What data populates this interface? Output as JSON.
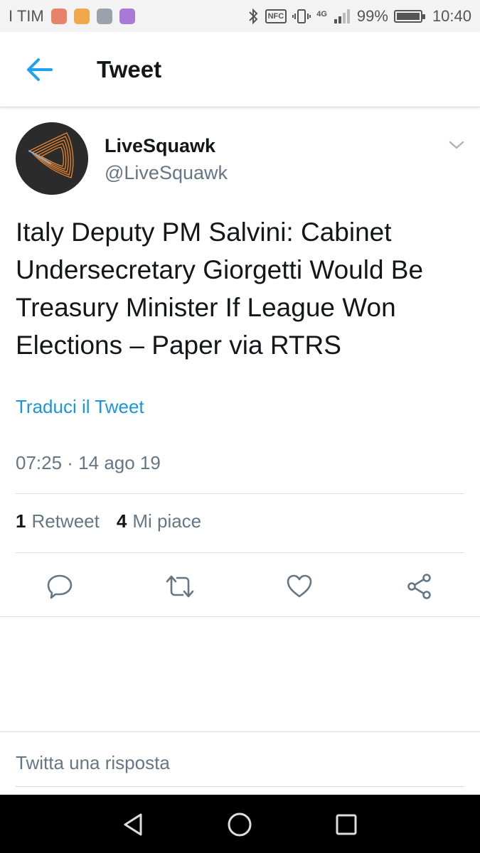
{
  "status_bar": {
    "carrier": "I TIM",
    "network": "4G",
    "nfc_label": "NFC",
    "battery_percent_label": "99%",
    "battery_level": 0.99,
    "time": "10:40",
    "notification_icons": [
      {
        "name": "mail-notification-icon",
        "color": "#e8836b"
      },
      {
        "name": "lock-notification-icon",
        "color": "#f0a84a"
      },
      {
        "name": "gallery-notification-icon",
        "color": "#9aa3ab"
      },
      {
        "name": "keyboard-notification-icon",
        "color": "#a879d6"
      }
    ]
  },
  "app_bar": {
    "title": "Tweet",
    "back_icon": "arrow-left-icon",
    "accent_color": "#1da1f2"
  },
  "tweet": {
    "author_name": "LiveSquawk",
    "author_handle": "@LiveSquawk",
    "text": "Italy Deputy PM Salvini: Cabinet Undersecretary Giorgetti Would Be Treasury Minister If League Won Elections – Paper  via RTRS",
    "translate_label": "Traduci il Tweet",
    "timestamp": "07:25 · 14 ago 19",
    "retweet_count": "1",
    "retweet_label": "Retweet",
    "like_count": "4",
    "like_label": "Mi piace"
  },
  "actions": [
    {
      "name": "reply-icon"
    },
    {
      "name": "retweet-icon"
    },
    {
      "name": "like-icon"
    },
    {
      "name": "share-icon"
    }
  ],
  "reply": {
    "placeholder": "Twitta una risposta"
  },
  "colors": {
    "link": "#1b95e0",
    "secondary_text": "#657786",
    "primary_text": "#14171a",
    "avatar_stroke": "#e8862f"
  }
}
